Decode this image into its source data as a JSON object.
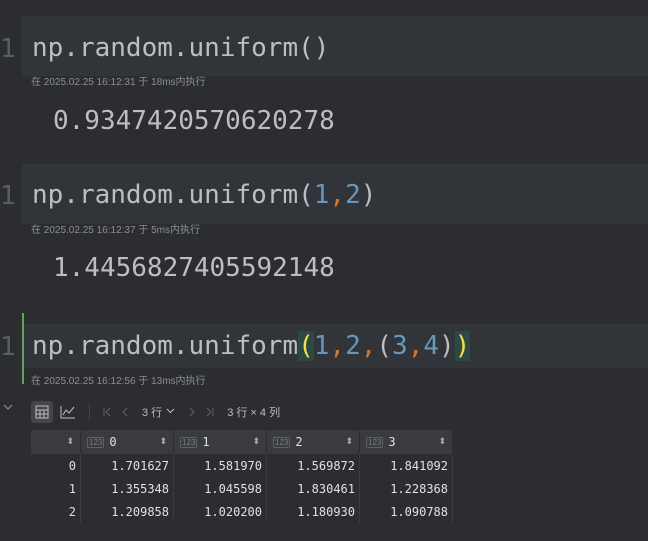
{
  "cells": [
    {
      "line_number": "1",
      "code_prefix": "np.random.uniform",
      "code_open": "(",
      "code_close": ")",
      "exec_info": "在 2025.02.25 16:12:31 于 18ms内执行",
      "output": "0.9347420570620278"
    },
    {
      "line_number": "1",
      "code_prefix": "np.random.uniform",
      "code_open": "(",
      "arg1": "1",
      "comma1": ",",
      "arg2": "2",
      "code_close": ")",
      "exec_info": "在 2025.02.25 16:12:37 于 5ms内执行",
      "output": "1.4456827405592148"
    },
    {
      "line_number": "1",
      "code_prefix": "np.random.uniform",
      "code_open": "(",
      "arg1": "1",
      "comma1": ",",
      "arg2": "2",
      "comma2": ",",
      "inner_open": "(",
      "arg3": "3",
      "comma3": ",",
      "arg4": "4",
      "inner_close": ")",
      "code_close": ")",
      "exec_info": "在 2025.02.25 16:12:56 于 13ms内执行"
    }
  ],
  "dataframe": {
    "toolbar": {
      "table_view_icon": "table-grid-icon",
      "chart_view_icon": "line-chart-icon",
      "first_icon": "first-page-icon",
      "prev_icon": "prev-page-icon",
      "next_icon": "next-page-icon",
      "last_icon": "last-page-icon",
      "rows_label": "3 行",
      "shape_label": "3 行 × 4 列"
    },
    "type_badge": "123",
    "columns": [
      "0",
      "1",
      "2",
      "3"
    ],
    "rows": [
      {
        "index": "0",
        "values": [
          "1.701627",
          "1.581970",
          "1.569872",
          "1.841092"
        ]
      },
      {
        "index": "1",
        "values": [
          "1.355348",
          "1.045598",
          "1.830461",
          "1.228368"
        ]
      },
      {
        "index": "2",
        "values": [
          "1.209858",
          "1.020200",
          "1.180930",
          "1.090788"
        ]
      }
    ]
  },
  "colors": {
    "background": "#2b2d30",
    "code_line_bg": "#313438",
    "number": "#6897bb",
    "comma": "#cc7832",
    "matched_paren": "#f2e14c",
    "active_cell_bar": "#5fa65a"
  }
}
